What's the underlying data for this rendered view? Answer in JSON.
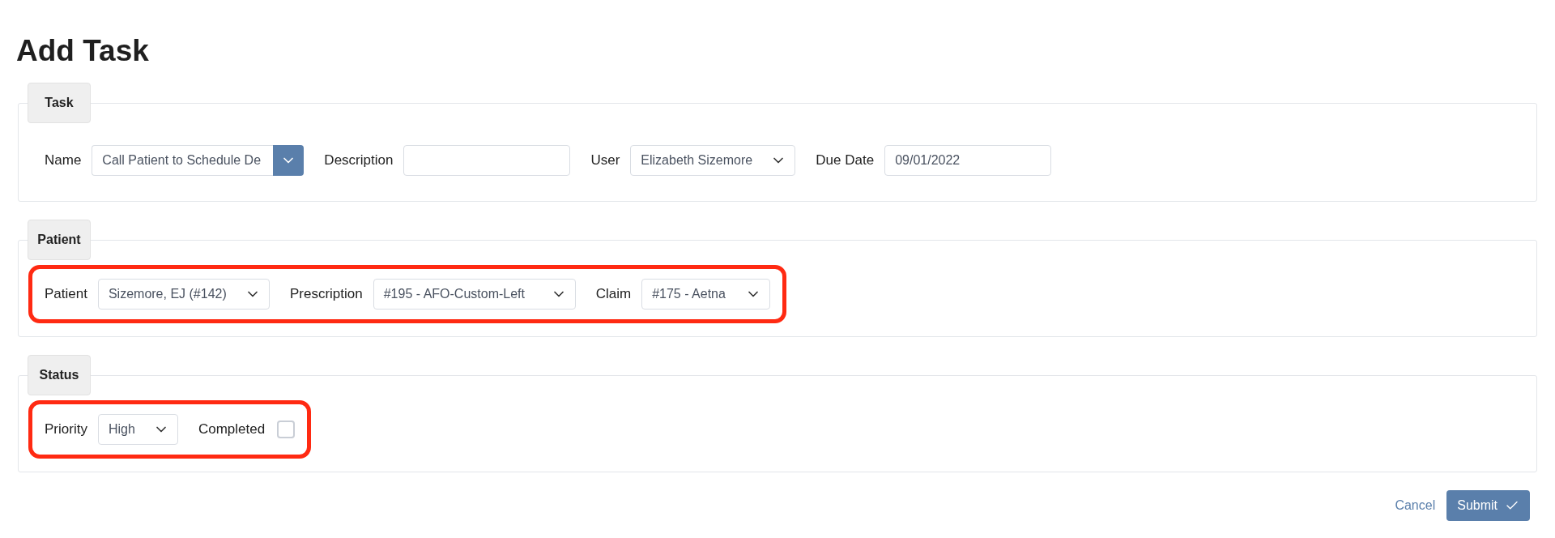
{
  "title": "Add Task",
  "sections": [
    {
      "legend": "Task",
      "highlighted": false,
      "fields": [
        {
          "kind": "combo",
          "label": "Name",
          "value": "Call Patient to Schedule De"
        },
        {
          "kind": "text",
          "label": "Description"
        },
        {
          "kind": "select",
          "label": "User",
          "value": "Elizabeth Sizemore"
        },
        {
          "kind": "text",
          "label": "Due Date",
          "value": "09/01/2022"
        }
      ]
    },
    {
      "legend": "Patient",
      "highlighted": true,
      "fields": [
        {
          "kind": "select",
          "label": "Patient",
          "value": "Sizemore, EJ (#142)"
        },
        {
          "kind": "select",
          "label": "Prescription",
          "value": "#195 - AFO-Custom-Left"
        },
        {
          "kind": "select",
          "label": "Claim",
          "value": "#175 - Aetna"
        }
      ]
    },
    {
      "legend": "Status",
      "highlighted": true,
      "fields": [
        {
          "kind": "select",
          "label": "Priority",
          "value": "High"
        },
        {
          "kind": "checkbox",
          "label": "Completed",
          "checked": false
        }
      ]
    }
  ],
  "actions": {
    "cancel": "Cancel",
    "submit": "Submit"
  }
}
